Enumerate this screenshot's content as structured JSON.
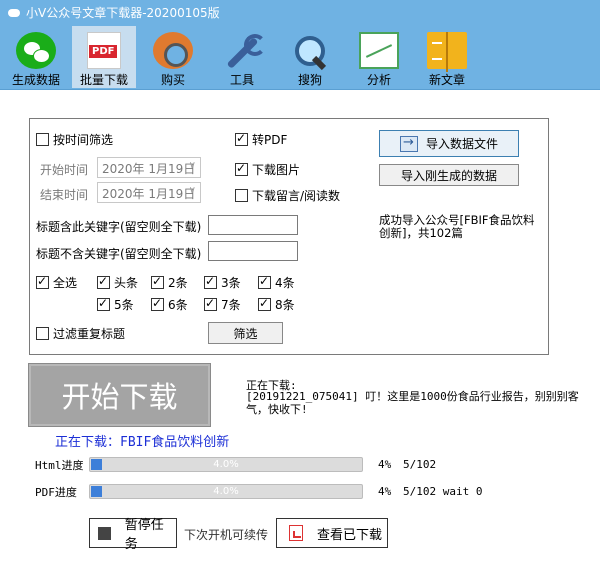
{
  "window": {
    "title": "小V公众号文章下载器-20200105版"
  },
  "toolbar": [
    {
      "label": "生成数据",
      "icon": "wechat-icon"
    },
    {
      "label": "批量下载",
      "icon": "pdf-icon"
    },
    {
      "label": "购买",
      "icon": "gear-icon"
    },
    {
      "label": "工具",
      "icon": "wrench-icon"
    },
    {
      "label": "搜狗",
      "icon": "search-icon"
    },
    {
      "label": "分析",
      "icon": "chart-icon"
    },
    {
      "label": "新文章",
      "icon": "book-icon"
    }
  ],
  "options": {
    "filter_by_time": "按时间筛选",
    "start_time_label": "开始时间",
    "start_time_value": "2020年 1月19日",
    "end_time_label": "结束时间",
    "end_time_value": "2020年 1月19日",
    "to_pdf": "转PDF",
    "download_images": "下载图片",
    "download_comments": "下载留言/阅读数",
    "title_include_label": "标题含此关键字(留空则全下载)",
    "title_exclude_label": "标题不含关键字(留空则全下载)",
    "select_all": "全选",
    "position_labels": [
      "头条",
      "2条",
      "3条",
      "4条",
      "5条",
      "6条",
      "7条",
      "8条"
    ],
    "dedupe_titles": "过滤重复标题",
    "filter_button": "筛选",
    "import_file_button": "导入数据文件",
    "import_latest_button": "导入刚生成的数据",
    "import_status": "成功导入公众号[FBIF食品饮料创新]，共102篇"
  },
  "download": {
    "start_button": "开始下载",
    "status_title": "正在下载:",
    "status_detail": "[20191221_075041] 叮！这里是1000份食品行业报告，别别别客气，快收下!",
    "current_line": "正在下载：FBIF食品饮料创新",
    "html_label": "Html进度",
    "html_progress_text": "4.0%",
    "html_percent": "4%",
    "html_count": "5/102",
    "html_fraction": 0.04,
    "pdf_label": "PDF进度",
    "pdf_progress_text": "4.0%",
    "pdf_percent": "4%",
    "pdf_count": "5/102 wait 0",
    "pdf_fraction": 0.04
  },
  "footer": {
    "pause_button": "暂停任务",
    "resume_hint": "下次开机可续传",
    "view_downloaded_button": "查看已下载"
  }
}
